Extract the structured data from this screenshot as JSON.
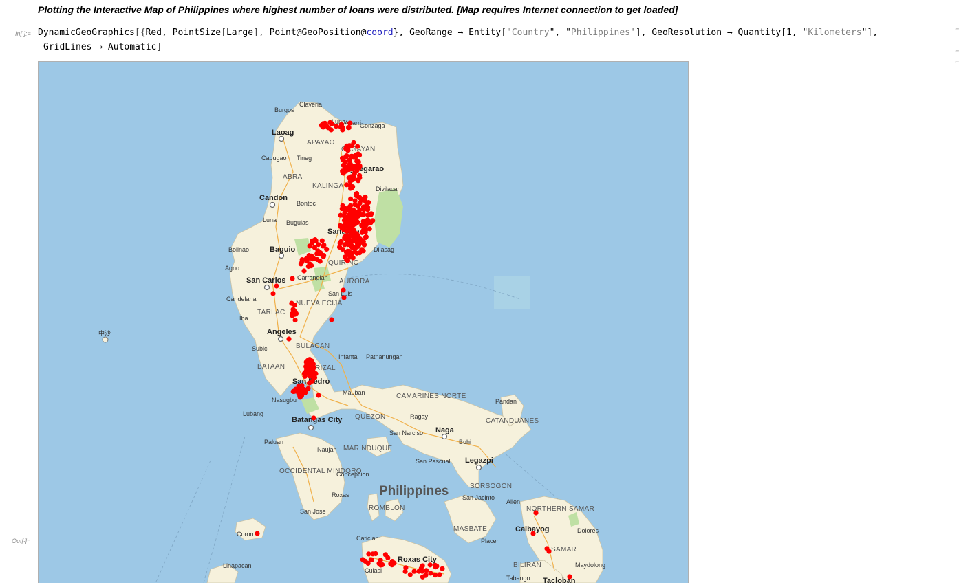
{
  "heading": "Plotting the Interactive Map of Philippines where highest number of loans were distributed. [Map requires Internet connection to get loaded]",
  "input_label": "In[∙]:=",
  "output_label": "Out[∙]=",
  "code": {
    "t1": "DynamicGeoGraphics",
    "t2": "[{",
    "t3": "Red, PointSize",
    "t4": "[",
    "t5": "Large",
    "t6": "], ",
    "t7": "Point@GeoPosition@",
    "t8": "coord",
    "t9": "}, GeoRange → Entity",
    "t10": "[\"",
    "t11": "Country",
    "t12": "\", \"",
    "t13": "Philippines",
    "t14": "\"], GeoResolution → Quantity",
    "t15": "[1, \"",
    "t16": "Kilometers",
    "t17": "\"],",
    "line2": "GridLines → Automatic",
    "line2_close": "]"
  },
  "map": {
    "country_label": "Philippines",
    "colors": {
      "sea": "#9dc8e6",
      "land": "#f6f1dc",
      "park": "#bfe0a4",
      "road": "#f0b04a",
      "marker": "#ff0000"
    },
    "places": [
      "Claveria",
      "Burgos",
      "Luna",
      "Aparri",
      "Gonzaga",
      "Laoag",
      "APAYAO",
      "CAGAYAN",
      "Cabugao",
      "Tineg",
      "ABRA",
      "Tuguegarao",
      "KALINGA",
      "Divilacan",
      "Candon",
      "Bontoc",
      "Luna",
      "Buguias",
      "Bolinao",
      "Baguio",
      "Santiago",
      "Dilasag",
      "Agno",
      "QUIRINO",
      "San Carlos",
      "Carranglan",
      "AURORA",
      "Candelaria",
      "NUEVA ECIJA",
      "San Luis",
      "TARLAC",
      "Iba",
      "Angeles",
      "BULACAN",
      "Subic",
      "Infanta",
      "Patnanungan",
      "BATAAN",
      "RIZAL",
      "San Pedro",
      "Mauban",
      "CAMARINES NORTE",
      "Nasugbu",
      "Pandan",
      "Lubang",
      "Batangas City",
      "QUEZON",
      "Ragay",
      "CATANDUANES",
      "San Narciso",
      "Naga",
      "Buhi",
      "Paluan",
      "Naujan",
      "MARINDUQUE",
      "San Pascual",
      "Legazpi",
      "OCCIDENTAL MINDORO",
      "Concepcion",
      "SORSOGON",
      "Roxas",
      "San Jacinto",
      "Allen",
      "San Jose",
      "ROMBLON",
      "NORTHERN SAMAR",
      "Calbayog",
      "Dolores",
      "MASBATE",
      "Placer",
      "SAMAR",
      "Coron",
      "Caticlan",
      "Roxas City",
      "Culasi",
      "BILIRAN",
      "Maydolong",
      "Linapacan",
      "Tabango",
      "Tacloban",
      "中沙"
    ]
  }
}
